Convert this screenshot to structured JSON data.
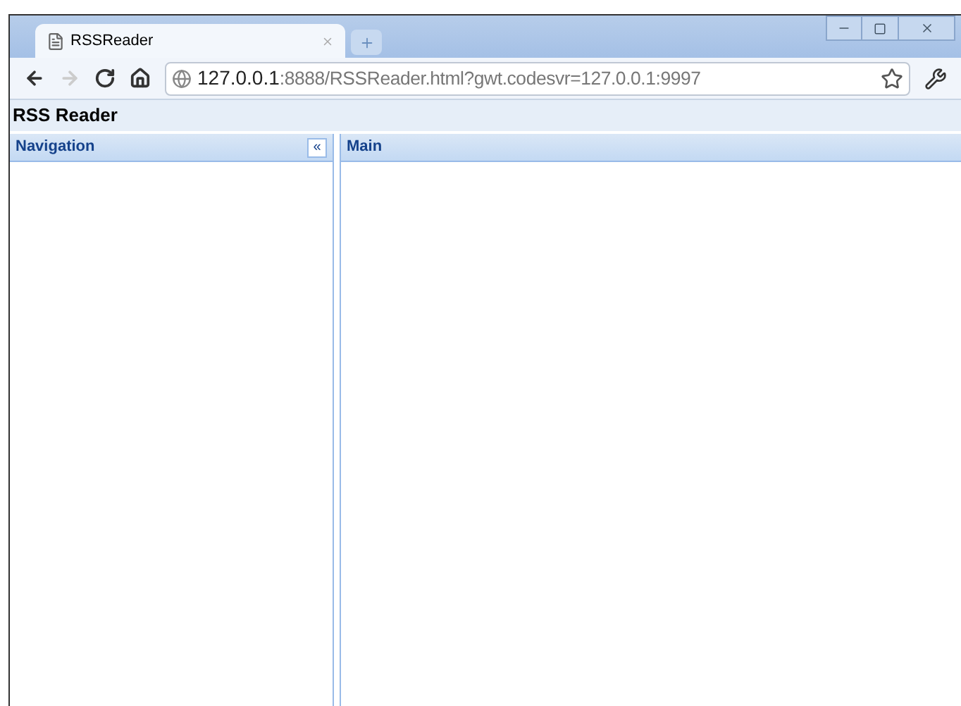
{
  "tabs": [
    {
      "title": "RSSReader",
      "selected": true
    }
  ],
  "address_bar": {
    "host": "127.0.0.1",
    "rest": ":8888/RSSReader.html?gwt.codesvr=127.0.0.1:9997"
  },
  "page": {
    "title": "RSS Reader",
    "panels": [
      {
        "kind": "side",
        "title": "Navigation",
        "collapse": "«"
      },
      {
        "kind": "main",
        "title": "Main"
      }
    ]
  }
}
